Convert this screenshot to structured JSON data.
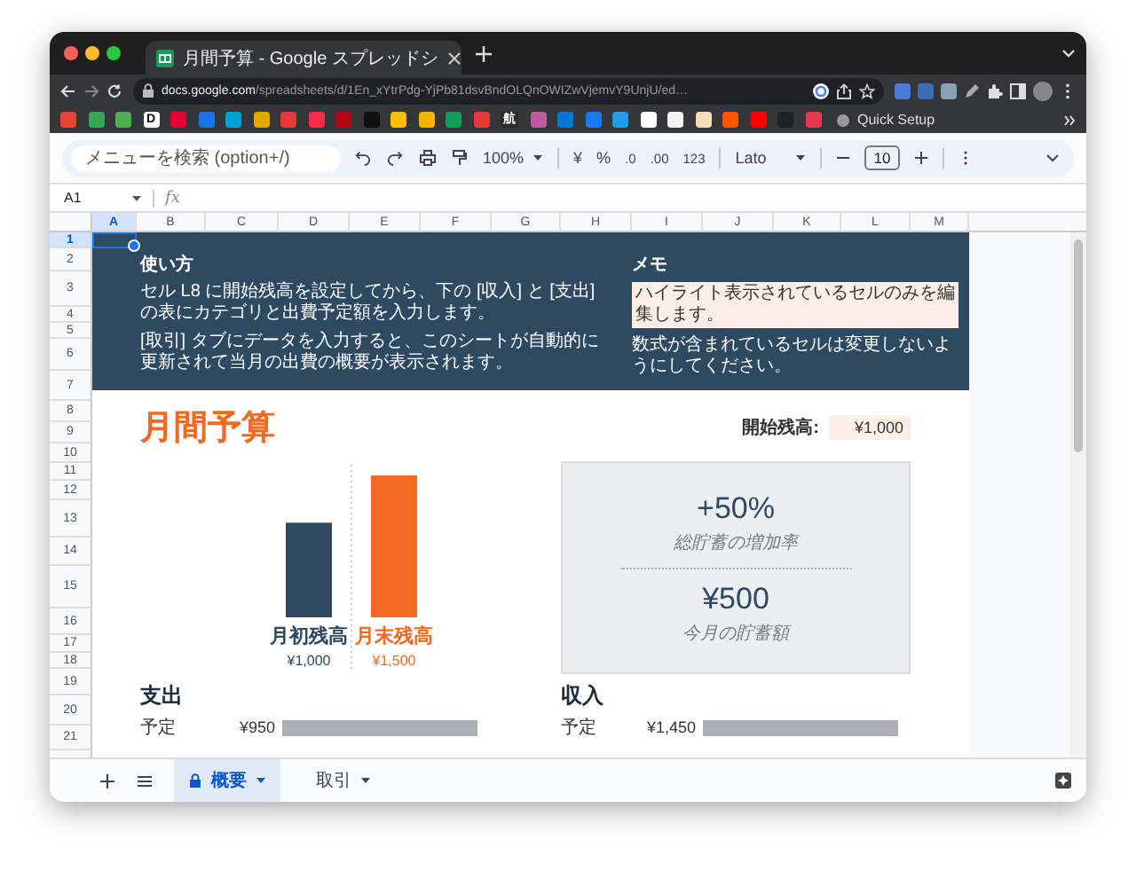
{
  "browser": {
    "tab_title": "月間予算 - Google スプレッドシ",
    "url_host": "docs.google.com",
    "url_path": "/spreadsheets/d/1En_xYtrPdg-YjPb81dsvBndOLQnOWIZwVjemvY9UnjU/ed…",
    "bookmarks": [
      {
        "color": "#ea4335"
      },
      {
        "color": "#34a853"
      },
      {
        "color": "#4caf50"
      },
      {
        "color": "#ffffff",
        "glyph": "D"
      },
      {
        "color": "#e60033"
      },
      {
        "color": "#1a73e8"
      },
      {
        "color": "#00a1d6"
      },
      {
        "color": "#e0a800"
      },
      {
        "color": "#e53935"
      },
      {
        "color": "#fa2d48"
      },
      {
        "color": "#b20710"
      },
      {
        "color": "#111111"
      },
      {
        "color": "#fbbc04"
      },
      {
        "color": "#f4b400"
      },
      {
        "color": "#0f9d58"
      },
      {
        "color": "#e53935"
      },
      {
        "color": "#2b2b2b",
        "glyph": "航"
      },
      {
        "color": "#c05aa0"
      },
      {
        "color": "#0078d4"
      },
      {
        "color": "#1877f2"
      },
      {
        "color": "#1d9bf0"
      },
      {
        "color": "#ffffff"
      },
      {
        "color": "#f1f1f1"
      },
      {
        "color": "#f5deb3"
      },
      {
        "color": "#ff5500"
      },
      {
        "color": "#ff0000"
      },
      {
        "color": "#202124"
      },
      {
        "color": "#e53950"
      }
    ],
    "quick_setup": "Quick Setup"
  },
  "toolbar": {
    "search": {
      "placeholder": "メニューを検索 (option+/)"
    },
    "zoom": "100%",
    "currency": "¥",
    "percent": "%",
    "decrease_decimals": ".0",
    "increase_decimals": ".00",
    "number_format": "123",
    "font": "Lato",
    "font_size": "10"
  },
  "formula_bar": {
    "cell": "A1",
    "fx": "fx"
  },
  "columns": [
    {
      "label": "A",
      "selected": true
    },
    {
      "label": "B",
      "selected": false
    },
    {
      "label": "C",
      "selected": false
    },
    {
      "label": "D",
      "selected": false
    },
    {
      "label": "E",
      "selected": false
    },
    {
      "label": "F",
      "selected": false
    },
    {
      "label": "G",
      "selected": false
    },
    {
      "label": "H",
      "selected": false
    },
    {
      "label": "I",
      "selected": false
    },
    {
      "label": "J",
      "selected": false
    },
    {
      "label": "K",
      "selected": false
    },
    {
      "label": "L",
      "selected": false
    },
    {
      "label": "M",
      "selected": false
    }
  ],
  "rows": [
    {
      "label": "1",
      "selected": true
    },
    {
      "label": "2",
      "selected": false
    },
    {
      "label": "3",
      "selected": false
    },
    {
      "label": "4",
      "selected": false
    },
    {
      "label": "5",
      "selected": false
    },
    {
      "label": "6",
      "selected": false
    },
    {
      "label": "7",
      "selected": false
    },
    {
      "label": "8",
      "selected": false
    },
    {
      "label": "9",
      "selected": false
    },
    {
      "label": "10",
      "selected": false
    },
    {
      "label": "11",
      "selected": false
    },
    {
      "label": "12",
      "selected": false
    },
    {
      "label": "13",
      "selected": false
    },
    {
      "label": "14",
      "selected": false
    },
    {
      "label": "15",
      "selected": false
    },
    {
      "label": "16",
      "selected": false
    },
    {
      "label": "17",
      "selected": false
    },
    {
      "label": "18",
      "selected": false
    },
    {
      "label": "19",
      "selected": false
    },
    {
      "label": "20",
      "selected": false
    },
    {
      "label": "21",
      "selected": false
    }
  ],
  "instructions": {
    "heading": "使い方",
    "paragraphs": [
      "セル L8 に開始残高を設定してから、下の [収入] と [支出] の表にカテゴリと出費予定額を入力します。",
      "[取引] タブにデータを入力すると、このシートが自動的に更新されて当月の出費の概要が表示されます。"
    ]
  },
  "memo": {
    "heading": "メモ",
    "highlight": "ハイライト表示されているセルのみを編集します。",
    "note": "数式が含まれているセルは変更しないようにしてください。"
  },
  "title": "月間予算",
  "starting_balance": {
    "label": "開始残高:",
    "value": "¥1,000"
  },
  "chart_data": {
    "type": "bar",
    "categories": [
      "月初残高",
      "月末残高"
    ],
    "values": [
      1000,
      1500
    ],
    "value_labels": [
      "¥1,000",
      "¥1,500"
    ]
  },
  "summary": {
    "rate": "+50%",
    "rate_label": "総貯蓄の増加率",
    "savings": "¥500",
    "savings_label": "今月の貯蓄額"
  },
  "expenses": {
    "heading": "支出",
    "rows": [
      {
        "label": "予定",
        "amount": "¥950"
      }
    ]
  },
  "income": {
    "heading": "収入",
    "rows": [
      {
        "label": "予定",
        "amount": "¥1,450"
      }
    ]
  },
  "sheets": [
    {
      "name": "概要",
      "selected": true,
      "locked": true
    },
    {
      "name": "取引",
      "selected": false,
      "locked": false
    }
  ]
}
